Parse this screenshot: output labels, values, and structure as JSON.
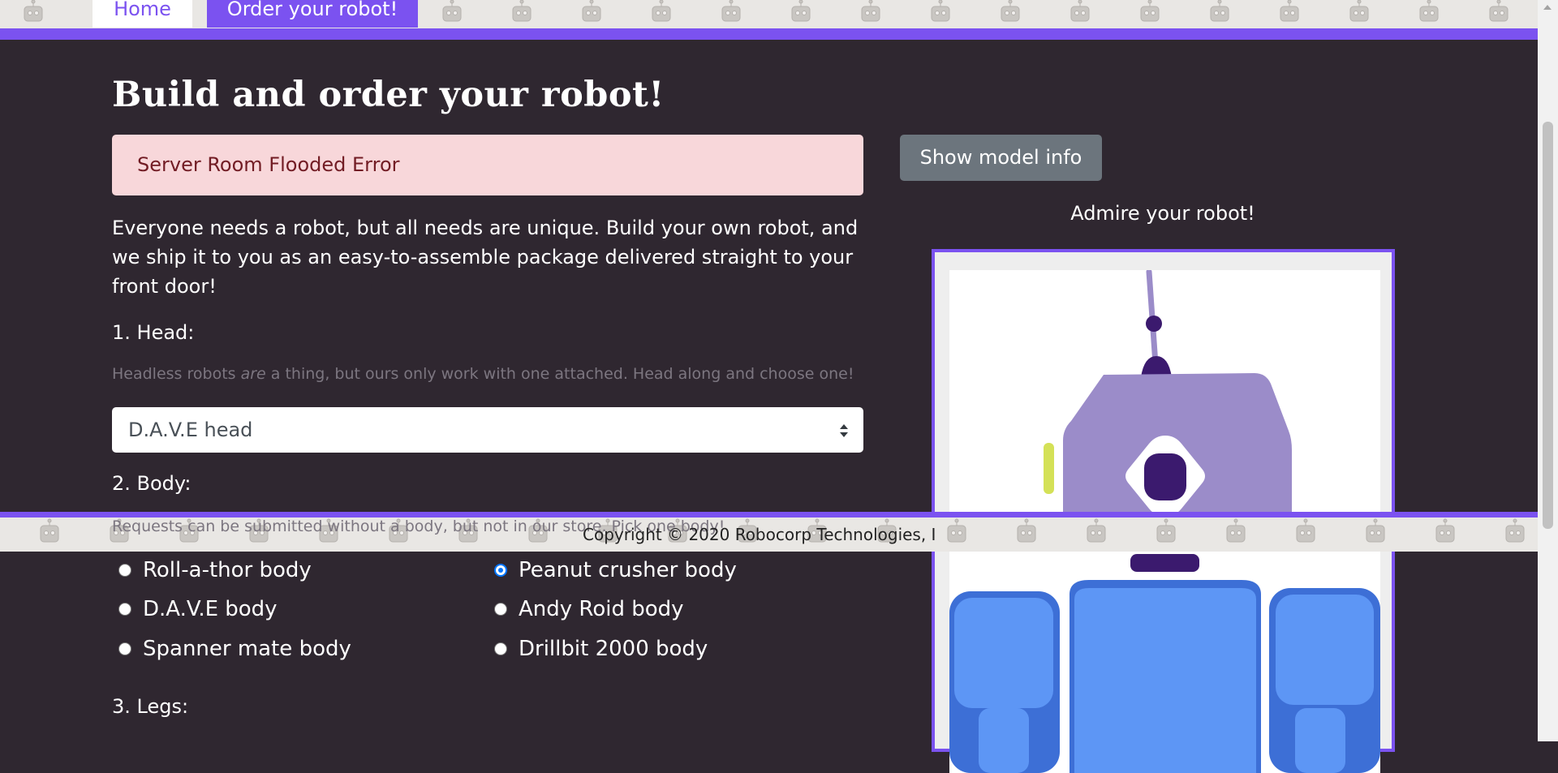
{
  "nav": {
    "home_label": "Home",
    "order_label": "Order your robot!"
  },
  "page": {
    "title": "Build and order your robot!"
  },
  "alert": {
    "message": "Server Room Flooded Error"
  },
  "intro": {
    "text": "Everyone needs a robot, but all needs are unique. Build your own robot, and we ship it to you as an easy-to-assemble package delivered straight to your front door!"
  },
  "head": {
    "label": "1. Head:",
    "helper_before": "Headless robots ",
    "helper_em": "are",
    "helper_after": " a thing, but ours only work with one attached. Head along and choose one!",
    "selected": "D.A.V.E head"
  },
  "body": {
    "label": "2. Body:",
    "helper": "Requests can be submitted without a body, but not in our store. Pick one body!",
    "options": [
      {
        "label": "Roll-a-thor body",
        "checked": false
      },
      {
        "label": "Peanut crusher body",
        "checked": true
      },
      {
        "label": "D.A.V.E body",
        "checked": false
      },
      {
        "label": "Andy Roid body",
        "checked": false
      },
      {
        "label": "Spanner mate body",
        "checked": false
      },
      {
        "label": "Drillbit 2000 body",
        "checked": false
      }
    ]
  },
  "legs": {
    "label": "3. Legs:"
  },
  "preview": {
    "show_model_label": "Show model info",
    "admire_label": "Admire your robot!"
  },
  "footer": {
    "copyright": "Copyright © 2020 Robocorp Technologies, I"
  },
  "colors": {
    "brand_purple": "#7b52f0",
    "page_bg": "#2f2730",
    "alert_bg": "#f8d7da",
    "alert_text": "#721c24",
    "robot_head": "#9b8cc9",
    "robot_dark": "#3b1a6e",
    "robot_body": "#5d96f5",
    "robot_ears": "#d4e157"
  }
}
